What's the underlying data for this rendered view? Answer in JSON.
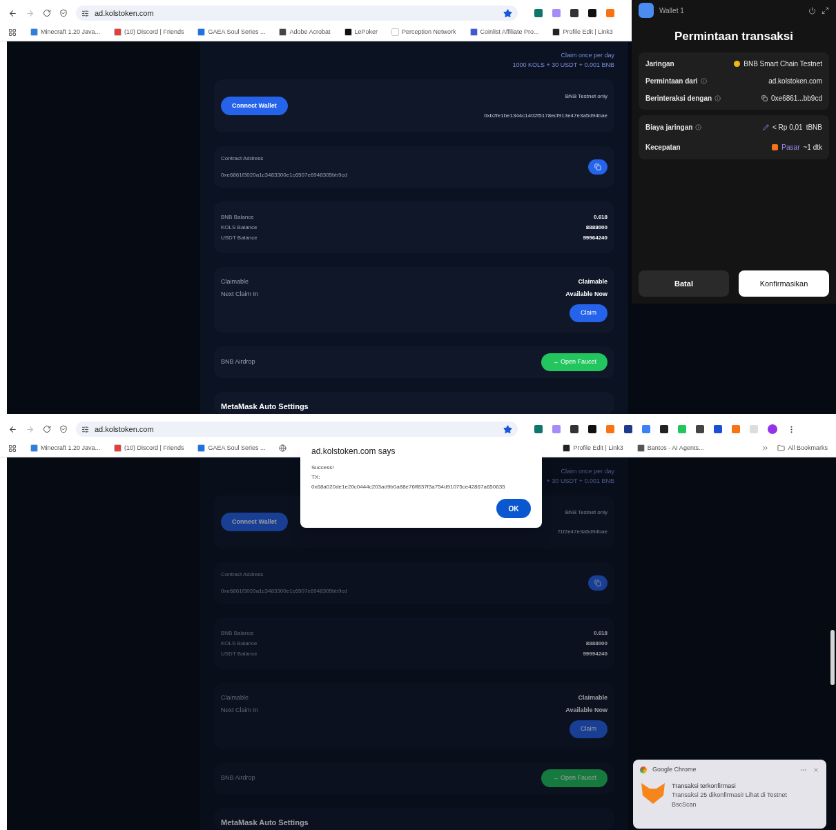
{
  "screens": [
    {
      "kind": "confirm",
      "dimmed": false,
      "toolbar": {
        "url": "ad.kolstoken.com"
      },
      "bookmarks": [
        {
          "label": "Minecraft 1.20 Java...",
          "color": "#2b7de9"
        },
        {
          "label": "(10) Discord | Friends",
          "color": "#e0413a"
        },
        {
          "label": "GAEA Soul Series ...",
          "color": "#1a73e8"
        },
        {
          "label": "Adobe Acrobat",
          "color": "#444444"
        },
        {
          "label": "LePoker",
          "color": "#111111"
        },
        {
          "label": "Perception Network",
          "color": "#ffffff"
        },
        {
          "label": "Coinlist Affiliate Pro...",
          "color": "#3b5bdb"
        },
        {
          "label": "Profile Edit | Link3",
          "color": "#222222"
        }
      ],
      "page": {
        "claim_note": "Claim once per day",
        "reward": "1000 KOLS + 30 USDT + 0.001 BNB",
        "connect_button": "Connect Wallet",
        "network_note": "BNB Testnet only",
        "wallet_address": "0xb2fe1be1344c1402f5178ecf913e47e3a5d94bae",
        "contract_label": "Contract Address",
        "contract_address": "0xe6861f3020a1c3483300e1c6507e6948305bb9cd",
        "balances": [
          {
            "label": "BNB Balance",
            "value": "0.618"
          },
          {
            "label": "KOLS Balance",
            "value": "8888000"
          },
          {
            "label": "USDT Balance",
            "value": "99964240"
          }
        ],
        "claim_rows": [
          {
            "label": "Claimable",
            "value": "Claimable"
          },
          {
            "label": "Next Claim In",
            "value": "Available Now"
          }
        ],
        "claim_button": "Claim",
        "airdrop_label": "BNB Airdrop",
        "faucet_button": "→ Open Faucet",
        "settings_heading": "MetaMask Auto Settings"
      },
      "wallet": {
        "account": "Wallet 1",
        "title": "Permintaan transaksi",
        "details": [
          {
            "kind": "network",
            "label": "Jaringan",
            "value": "BNB Smart Chain Testnet",
            "info": false
          },
          {
            "kind": "text",
            "label": "Permintaan dari",
            "value": "ad.kolstoken.com",
            "info": true
          },
          {
            "kind": "contract",
            "label": "Berinteraksi dengan",
            "value": "0xe6861...bb9cd",
            "info": true
          }
        ],
        "fees": [
          {
            "kind": "fee",
            "label": "Biaya jaringan",
            "value": "< Rp 0,01",
            "value_2": "tBNB",
            "info": true
          },
          {
            "kind": "speed",
            "label": "Kecepatan",
            "value": "Pasar",
            "value_2": "~1 dtk",
            "info": false
          }
        ],
        "cancel": "Batal",
        "confirm": "Konfirmasikan"
      }
    },
    {
      "kind": "alert",
      "dimmed": true,
      "toolbar": {
        "url": "ad.kolstoken.com"
      },
      "bookmarks": [
        {
          "label": "Minecraft 1.20 Java...",
          "color": "#2b7de9"
        },
        {
          "label": "(10) Discord | Friends",
          "color": "#e0413a"
        },
        {
          "label": "GAEA Soul Series ...",
          "color": "#1a73e8"
        }
      ],
      "bookmarks_right": [
        {
          "label": "Profile Edit | Link3",
          "color": "#222222"
        },
        {
          "label": "Bantos - AI Agents...",
          "color": "#555555"
        }
      ],
      "all_bookmarks": "All Bookmarks",
      "page": {
        "claim_note": "Claim once per day",
        "reward": "+ 30 USDT + 0.001 BNB",
        "connect_button": "Connect Wallet",
        "network_note": "BNB Testnet only",
        "wallet_address": "f1f2e47e3a5d94bae",
        "contract_label": "Contract Address",
        "contract_address": "0xe6861f3020a1c3483300e1c6507e6948305bb9cd",
        "balances": [
          {
            "label": "BNB Balance",
            "value": "0.618"
          },
          {
            "label": "KOLS Balance",
            "value": "8888000"
          },
          {
            "label": "USDT Balance",
            "value": "99994240"
          }
        ],
        "claim_rows": [
          {
            "label": "Claimable",
            "value": "Claimable"
          },
          {
            "label": "Next Claim In",
            "value": "Available Now"
          }
        ],
        "claim_button": "Claim",
        "airdrop_label": "BNB Airdrop",
        "faucet_button": "→ Open Faucet",
        "settings_heading": "MetaMask Auto Settings"
      },
      "alert": {
        "title": "ad.kolstoken.com says",
        "lines": [
          "Success!",
          "TX:",
          "0x68a020de1e20c0444c203ad9b0a88e76ff837f3a754d91075ce42867a650635"
        ],
        "button": "OK"
      },
      "notification": {
        "app": "Google Chrome",
        "title": "Transaksi terkonfirmasi",
        "body": "Transaksi 25 dikonfirmasi! Lihat di Testnet BscScan"
      }
    }
  ]
}
